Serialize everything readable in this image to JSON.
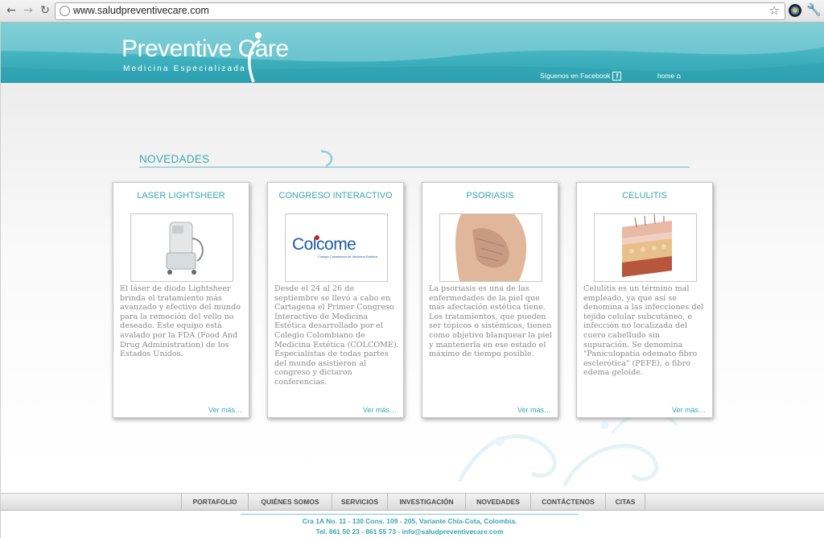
{
  "browser": {
    "back_glyph": "←",
    "forward_glyph": "→",
    "reload_glyph": "↻",
    "url": "www.saludpreventivecare.com",
    "star_glyph": "☆",
    "wrench_glyph": "🔧",
    "icons": [
      "back-icon",
      "forward-icon",
      "reload-icon",
      "page-icon",
      "bookmark-star-icon",
      "extension-icon",
      "wrench-icon"
    ]
  },
  "header": {
    "logo_main": "Preventive Care",
    "logo_sub": "Medicina Especializada",
    "facebook_label": "Síguenos en Facebook",
    "facebook_glyph": "f",
    "home_label": "home",
    "home_glyph": "⌂",
    "colors": {
      "teal": "#3fb0bd",
      "teal_light": "#70c9d1"
    }
  },
  "section": {
    "title": "NOVEDADES"
  },
  "cards": [
    {
      "title": "LASER LIGHTSHEER",
      "text": "El láser de diodo Lightsheer brinda el tratamiento más avanzado y efectivo del mundo para la remoción del vello no deseado. Este equipo está avalado por la FDA (Food And Drug Administration) de los Estados Unidos.",
      "more": "Ver más…",
      "image": "laser-machine-image"
    },
    {
      "title": "CONGRESO INTERACTIVO",
      "text": "Desde el 24 al 26 de septiembre se llevó a cabo en Cartagena el Primer Congreso Interactivo de Medicina Estética desarrollado por el Colegio Colombiano de Medicina Estética (COLCOME). Especialistas de todas partes del mundo asistieron al congreso y dictaron conferencias.",
      "more": "Ver más…",
      "image": "colcome-logo-image",
      "logo_text": "Colcome",
      "logo_caption": "Colegio Colombiano de Medicina Estética"
    },
    {
      "title": "PSORIASIS",
      "text": "La psoriasis es una de las enfermedades de la piel que más afectación estética tiene. Los tratamientos, que pueden ser tópicos o sistémicos, tienen como objetivo blanquear la piel y mantenerla en ese estado el máximo de tiempo posible.",
      "more": "Ver más…",
      "image": "psoriasis-elbow-image"
    },
    {
      "title": "CELULITIS",
      "text": "Celulitis es un término mal empleado, ya que así se denomina a las infecciones del tejido celular subcutáneo, e infección no localizada del cuero cabelludo sin supuración. Se denomina \"Paniculopatía edemato fibro esclerótica\" (PEFE), o fibro edema geloide.",
      "more": "Ver más…",
      "image": "skin-layers-image"
    }
  ],
  "footer": {
    "nav": [
      "PORTAFOLIO",
      "QUIÉNES SOMOS",
      "SERVICIOS",
      "INVESTIGACIÓN",
      "NOVEDADES",
      "CONTÁCTENOS",
      "CITAS"
    ],
    "address": "Cra 1A No. 11 - 130 Cons. 109 - 205, Variante Chía-Cota, Colombia.",
    "contact": "Tel. 861 50 23 - 861 55 73 - info@saludpreventivecare.com"
  }
}
